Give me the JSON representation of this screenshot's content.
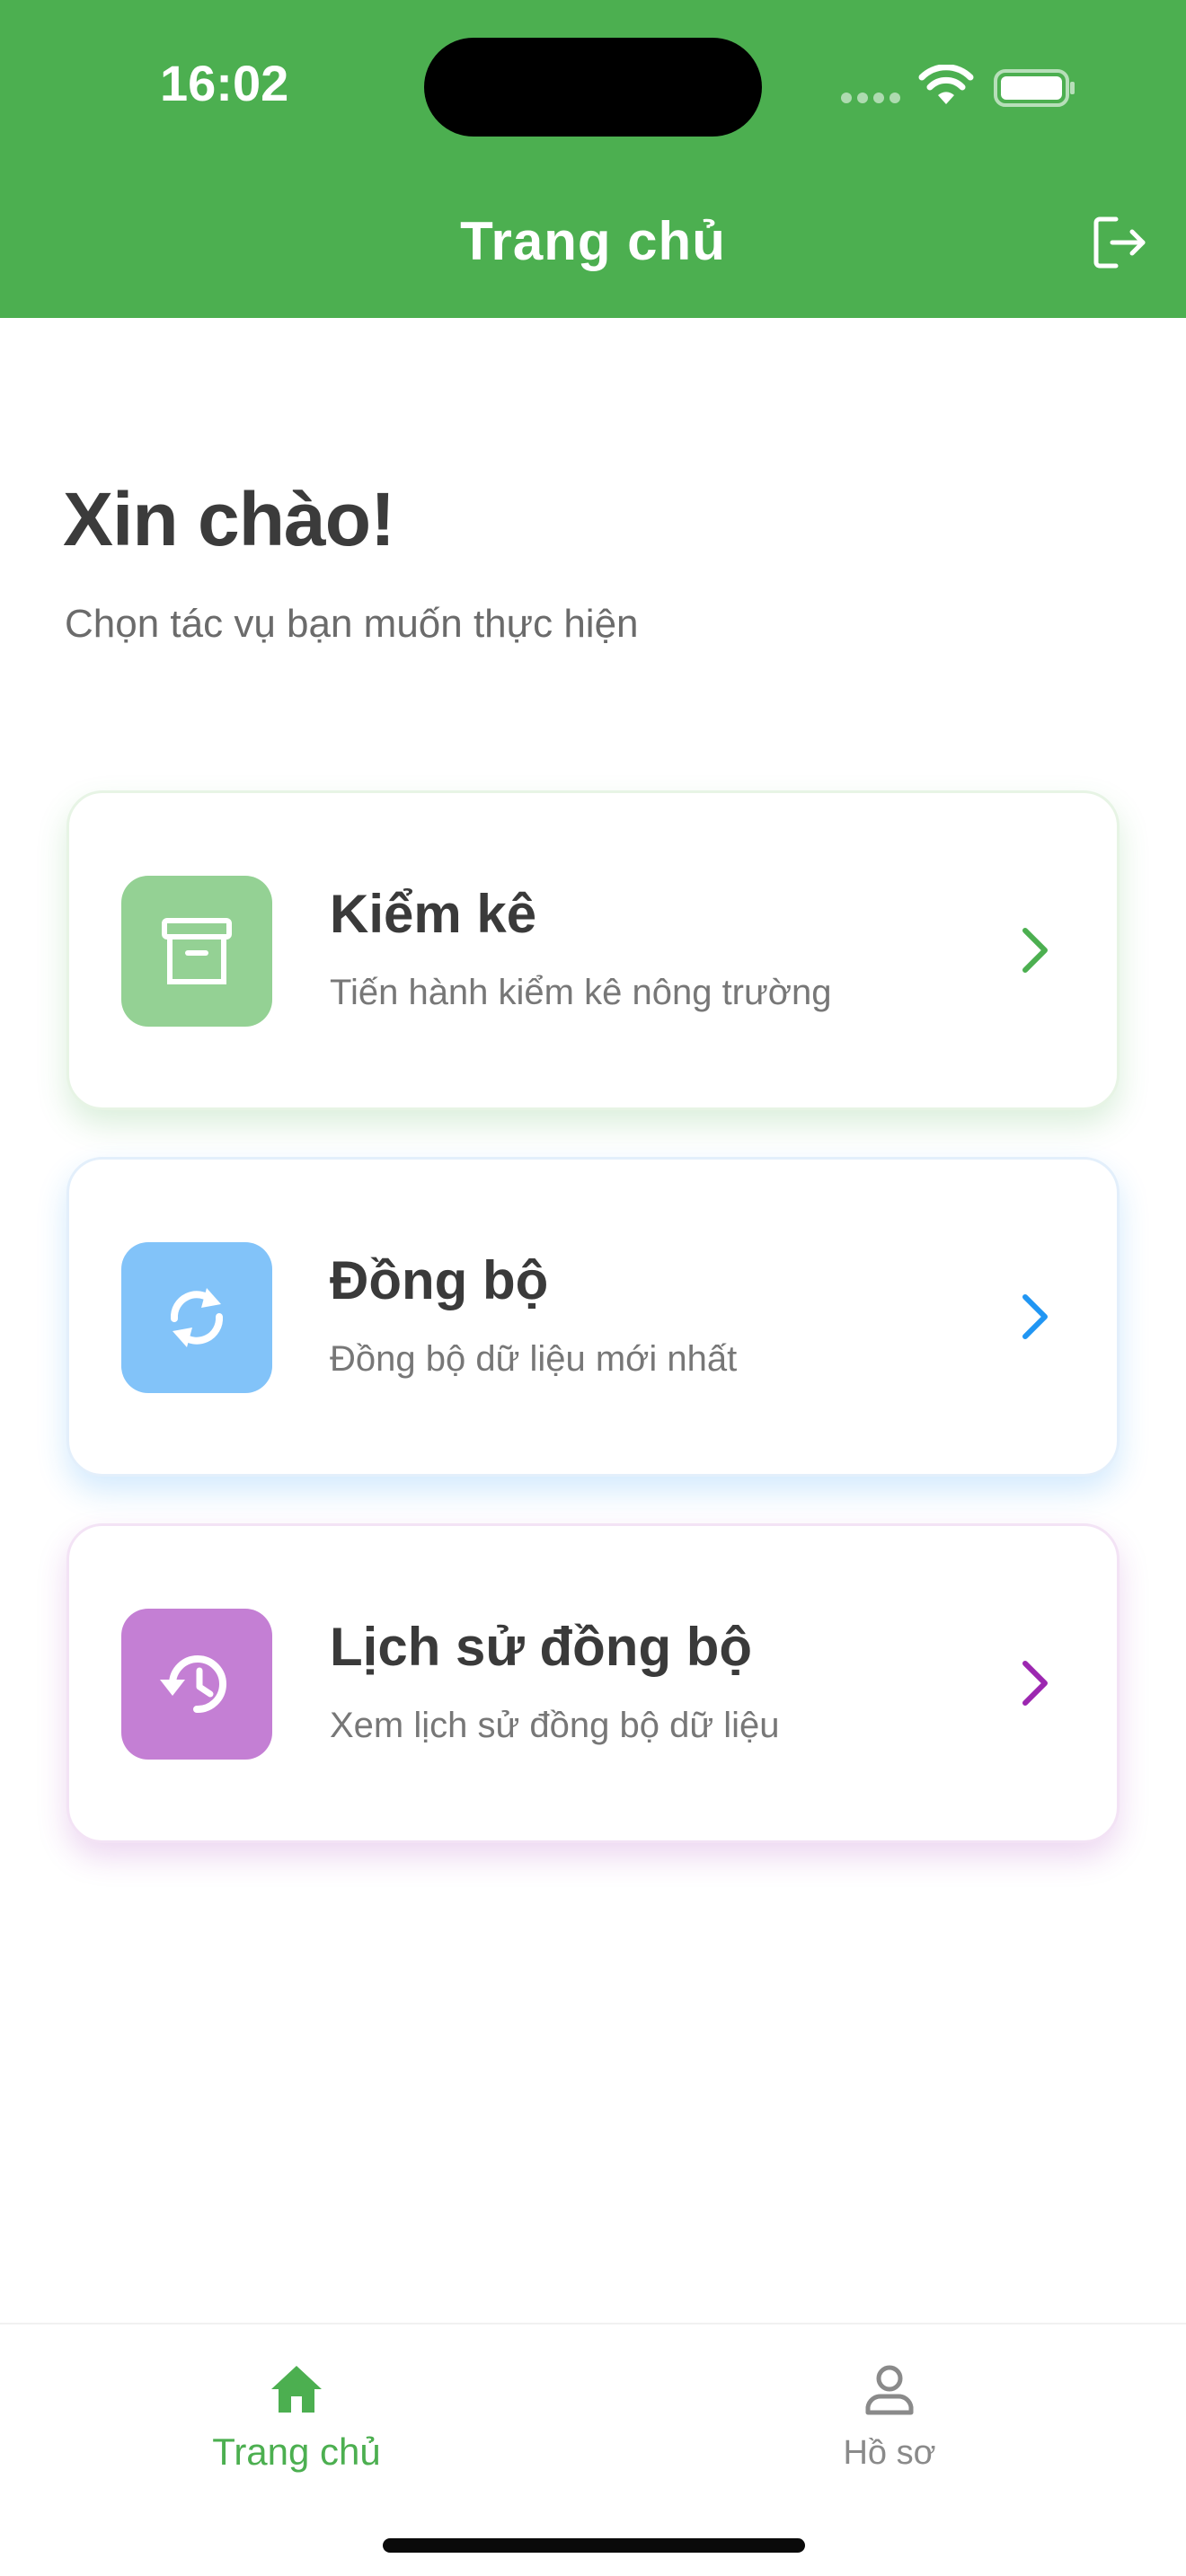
{
  "status_bar": {
    "time": "16:02"
  },
  "header": {
    "title": "Trang chủ",
    "logout_icon": "logout-icon",
    "background": "#4CAF50"
  },
  "greeting": {
    "title": "Xin chào!",
    "subtitle": "Chọn tác vụ bạn muốn thực hiện"
  },
  "cards": [
    {
      "title": "Kiểm kê",
      "description": "Tiến hành kiểm kê nông trường",
      "icon": "archive-icon",
      "icon_bg": "#94D194",
      "accent": "#4CAF50"
    },
    {
      "title": "Đồng bộ",
      "description": "Đồng bộ dữ liệu mới nhất",
      "icon": "sync-icon",
      "icon_bg": "#82C3F9",
      "accent": "#2196F3"
    },
    {
      "title": "Lịch sử đồng bộ",
      "description": "Xem lịch sử đồng bộ dữ liệu",
      "icon": "history-icon",
      "icon_bg": "#C47FD4",
      "accent": "#9C27B0"
    }
  ],
  "bottom_nav": {
    "items": [
      {
        "label": "Trang chủ",
        "icon": "home-icon",
        "active": true
      },
      {
        "label": "Hồ sơ",
        "icon": "person-icon",
        "active": false
      }
    ]
  }
}
